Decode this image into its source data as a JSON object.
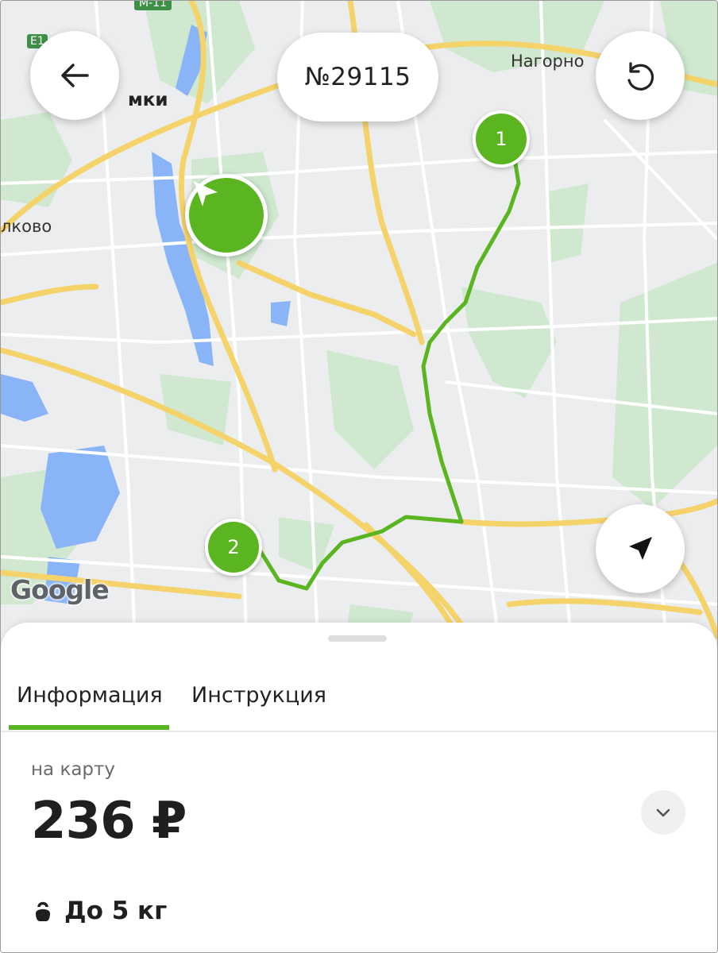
{
  "header": {
    "order_number": "№29115"
  },
  "map": {
    "labels": {
      "top_left": "мки",
      "top_right": "Нагорно",
      "left": "лково",
      "road_badge_left": "E1",
      "road_badge_top": "M-11"
    },
    "provider": "Google",
    "markers": {
      "start": "1",
      "end": "2"
    },
    "colors": {
      "route": "#5bb521",
      "water": "#8ab4f8",
      "park": "#cfe8cf",
      "road_major": "#f5d36b"
    }
  },
  "tabs": [
    {
      "label": "Информация",
      "active": true
    },
    {
      "label": "Инструкция",
      "active": false
    }
  ],
  "price": {
    "caption": "на карту",
    "value": "236 ₽"
  },
  "weight": {
    "label": "До 5 кг"
  },
  "icons": {
    "back": "arrow-left-icon",
    "refresh": "refresh-icon",
    "locate": "navigation-arrow-icon",
    "expand": "chevron-down-icon",
    "weight": "kettlebell-icon",
    "courier": "courier-arrow-icon"
  }
}
